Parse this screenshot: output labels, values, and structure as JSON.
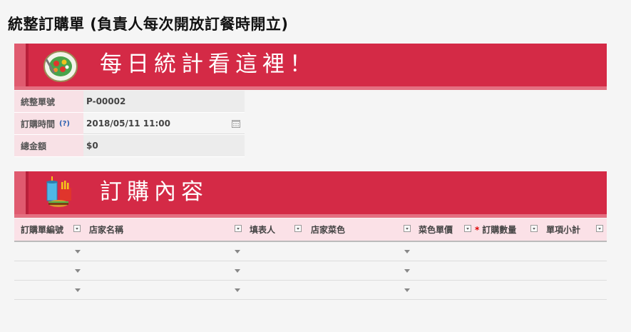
{
  "page": {
    "title": "統整訂購單 (負責人每次開放訂餐時開立)"
  },
  "section1": {
    "title": "每日統計看這裡！",
    "icon": "salad-plate-icon"
  },
  "form": {
    "rows": [
      {
        "label": "統整單號",
        "value": "P-00002"
      },
      {
        "label": "訂購時間",
        "help": "(?)",
        "value": "2018/05/11 11:00"
      },
      {
        "label": "總金額",
        "value": "$0"
      }
    ]
  },
  "section2": {
    "title": "訂購內容",
    "icon": "fast-food-icon"
  },
  "table": {
    "columns": [
      "訂購單編號",
      "店家名稱",
      "填表人",
      "店家菜色",
      "菜色單價",
      "訂購數量",
      "單項小計"
    ],
    "required_marker": "*",
    "row_count": 3
  },
  "colors": {
    "banner": "#d42a46",
    "header_bg": "#fbe1e7",
    "label_bg": "#f8e1e6"
  }
}
